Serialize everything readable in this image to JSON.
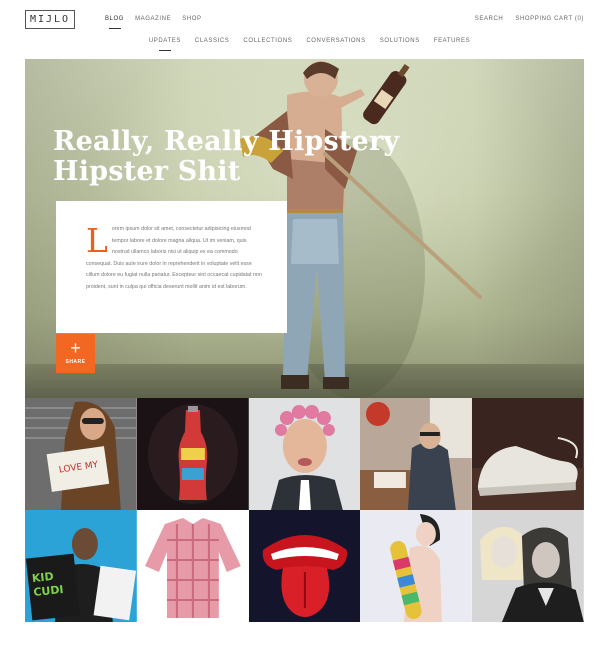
{
  "brand": {
    "logo": "MIJLO"
  },
  "nav": {
    "primary": [
      "BLOG",
      "MAGAZINE",
      "SHOP"
    ],
    "right": [
      "SEARCH",
      "SHOPPING CART (0)"
    ],
    "secondary": [
      "UPDATES",
      "CLASSICS",
      "COLLECTIONS",
      "CONVERSATIONS",
      "SOLUTIONS",
      "FEATURES"
    ]
  },
  "hero": {
    "title_line1": "Really, Really Hipstery",
    "title_line2": "Hipster Shit",
    "dropcap": "L",
    "body": "orem ipsum dolor sit amet, consectetur adipisicing eiusmod tempor labore et dolore magna aliqua. Ut im veniam, quis nostrud ullamco laboris nisi ut aliquip ex ea commodo consequat. Duis aute irure dolor in reprehenderit in voluptate velit esse cillum dolore eu fugiat nulla pariatur. Excepteur sint occaecat cupidatat non proident, sunt in culpa qui officia deserunt mollit anim id est laborum.",
    "share_label": "SHARE",
    "share_icon": "plus-icon",
    "accent": "#f26722"
  },
  "grid": {
    "tiles": [
      {
        "name": "girl-with-sign"
      },
      {
        "name": "cola-bottle"
      },
      {
        "name": "man-with-curlers"
      },
      {
        "name": "man-in-diner"
      },
      {
        "name": "white-sneaker"
      },
      {
        "name": "kid-cudi"
      },
      {
        "name": "plaid-shirt"
      },
      {
        "name": "rolling-stones-tongue"
      },
      {
        "name": "girl-with-skateboard"
      },
      {
        "name": "couple-portrait"
      }
    ]
  }
}
